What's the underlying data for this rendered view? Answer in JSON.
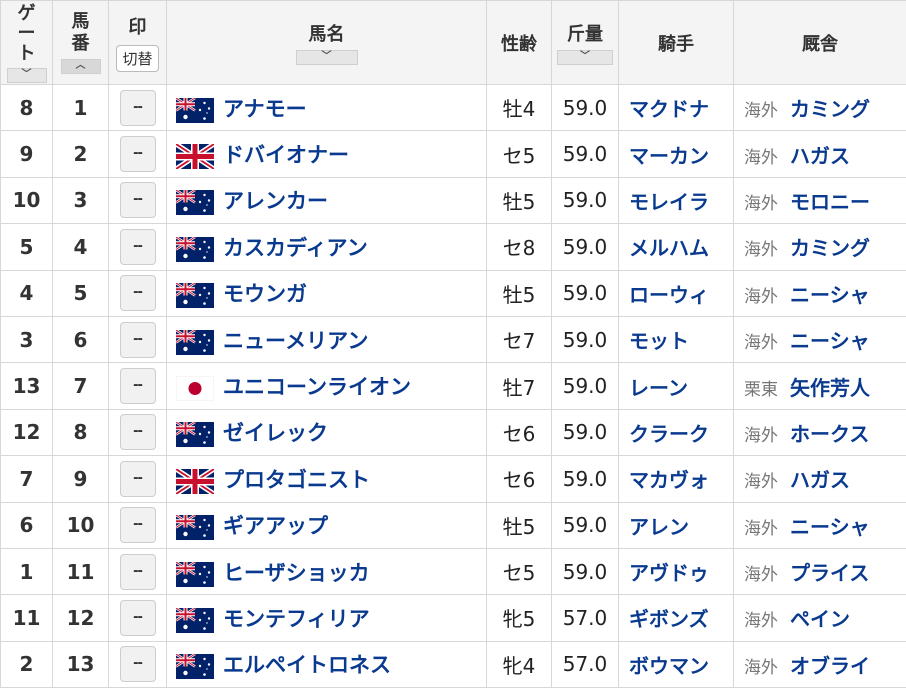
{
  "headers": {
    "gate": "ゲート",
    "number": "馬番",
    "mark": "印",
    "mark_toggle": "切替",
    "horse": "馬名",
    "sex_age": "性齢",
    "weight": "斤量",
    "jockey": "騎手",
    "stable": "厩舎"
  },
  "sort_icons": {
    "gate": "﹀",
    "number": "︿",
    "horse": "﹀",
    "weight": "﹀"
  },
  "colors": {
    "header_bg": "#f4f4f4",
    "link_blue": "#0a3a8f",
    "border": "#d7d7d7"
  },
  "rows": [
    {
      "gate": "8",
      "number": "1",
      "mark": "--",
      "flag": "australia-flag-icon",
      "horse": "アナモー",
      "sex_age": "牡4",
      "weight": "59.0",
      "jockey": "マクドナ",
      "region": "海外",
      "trainer": "カミング"
    },
    {
      "gate": "9",
      "number": "2",
      "mark": "--",
      "flag": "uk-flag-icon",
      "horse": "ドバイオナー",
      "sex_age": "セ5",
      "weight": "59.0",
      "jockey": "マーカン",
      "region": "海外",
      "trainer": "ハガス"
    },
    {
      "gate": "10",
      "number": "3",
      "mark": "--",
      "flag": "australia-flag-icon",
      "horse": "アレンカー",
      "sex_age": "牡5",
      "weight": "59.0",
      "jockey": "モレイラ",
      "region": "海外",
      "trainer": "モロニー"
    },
    {
      "gate": "5",
      "number": "4",
      "mark": "--",
      "flag": "australia-flag-icon",
      "horse": "カスカディアン",
      "sex_age": "セ8",
      "weight": "59.0",
      "jockey": "メルハム",
      "region": "海外",
      "trainer": "カミング"
    },
    {
      "gate": "4",
      "number": "5",
      "mark": "--",
      "flag": "australia-flag-icon",
      "horse": "モウンガ",
      "sex_age": "牡5",
      "weight": "59.0",
      "jockey": "ローウィ",
      "region": "海外",
      "trainer": "ニーシャ"
    },
    {
      "gate": "3",
      "number": "6",
      "mark": "--",
      "flag": "australia-flag-icon",
      "horse": "ニューメリアン",
      "sex_age": "セ7",
      "weight": "59.0",
      "jockey": "モット",
      "region": "海外",
      "trainer": "ニーシャ"
    },
    {
      "gate": "13",
      "number": "7",
      "mark": "--",
      "flag": "japan-flag-icon",
      "horse": "ユニコーンライオン",
      "sex_age": "牡7",
      "weight": "59.0",
      "jockey": "レーン",
      "region": "栗東",
      "trainer": "矢作芳人"
    },
    {
      "gate": "12",
      "number": "8",
      "mark": "--",
      "flag": "australia-flag-icon",
      "horse": "ゼイレック",
      "sex_age": "セ6",
      "weight": "59.0",
      "jockey": "クラーク",
      "region": "海外",
      "trainer": "ホークス"
    },
    {
      "gate": "7",
      "number": "9",
      "mark": "--",
      "flag": "uk-flag-icon",
      "horse": "プロタゴニスト",
      "sex_age": "セ6",
      "weight": "59.0",
      "jockey": "マカヴォ",
      "region": "海外",
      "trainer": "ハガス"
    },
    {
      "gate": "6",
      "number": "10",
      "mark": "--",
      "flag": "australia-flag-icon",
      "horse": "ギアアップ",
      "sex_age": "牡5",
      "weight": "59.0",
      "jockey": "アレン",
      "region": "海外",
      "trainer": "ニーシャ"
    },
    {
      "gate": "1",
      "number": "11",
      "mark": "--",
      "flag": "australia-flag-icon",
      "horse": "ヒーザショッカ",
      "sex_age": "セ5",
      "weight": "59.0",
      "jockey": "アヴドゥ",
      "region": "海外",
      "trainer": "プライス"
    },
    {
      "gate": "11",
      "number": "12",
      "mark": "--",
      "flag": "australia-flag-icon",
      "horse": "モンテフィリア",
      "sex_age": "牝5",
      "weight": "57.0",
      "jockey": "ギボンズ",
      "region": "海外",
      "trainer": "ペイン"
    },
    {
      "gate": "2",
      "number": "13",
      "mark": "--",
      "flag": "australia-flag-icon",
      "horse": "エルペイトロネス",
      "sex_age": "牝4",
      "weight": "57.0",
      "jockey": "ボウマン",
      "region": "海外",
      "trainer": "オブライ"
    }
  ]
}
